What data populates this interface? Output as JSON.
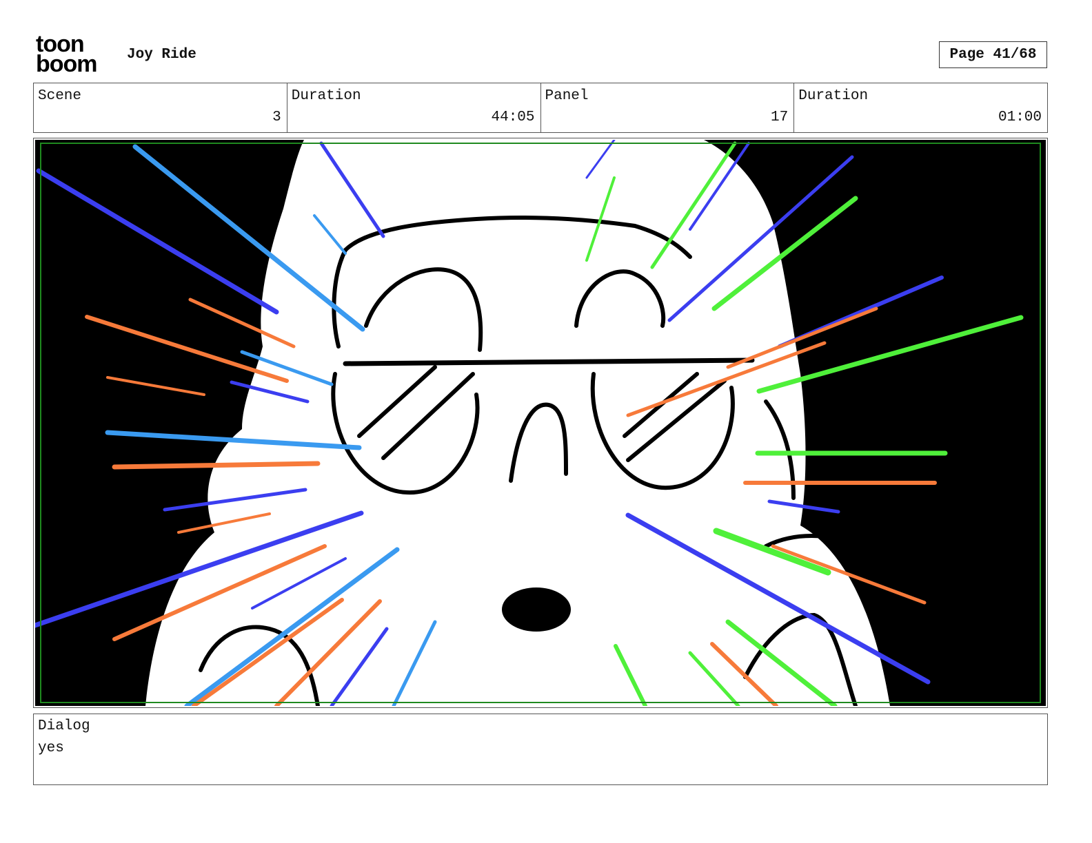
{
  "header": {
    "logo_line1": "toon",
    "logo_line2": "boom",
    "project_title": "Joy Ride",
    "page_label": "Page 41/68"
  },
  "info": {
    "scene_label": "Scene",
    "scene_value": "3",
    "scene_duration_label": "Duration",
    "scene_duration_value": "44:05",
    "panel_label": "Panel",
    "panel_value": "17",
    "panel_duration_label": "Duration",
    "panel_duration_value": "01:00"
  },
  "dialog": {
    "label": "Dialog",
    "text": "yes"
  },
  "colors": {
    "speed_blue": "#3b3ef0",
    "speed_light_blue": "#3a9af0",
    "speed_orange": "#f77a3a",
    "speed_green": "#4ff03a",
    "safe_frame": "#1f8a1f"
  }
}
